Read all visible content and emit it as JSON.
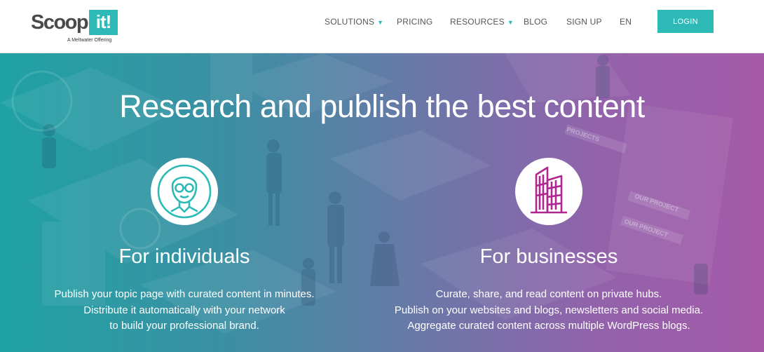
{
  "header": {
    "logo": {
      "word": "Scoop.",
      "box": "it!",
      "tagline": "A Meltwater Offering"
    },
    "nav": [
      {
        "label": "SOLUTIONS",
        "dropdown": true
      },
      {
        "label": "PRICING",
        "dropdown": false
      },
      {
        "label": "RESOURCES",
        "dropdown": true
      },
      {
        "label": "BLOG",
        "dropdown": false
      },
      {
        "label": "SIGN UP",
        "dropdown": false
      },
      {
        "label": "EN",
        "dropdown": false
      }
    ],
    "caret_glyph": "▼",
    "login_label": "LOGIN"
  },
  "hero": {
    "title": "Research and publish the best content",
    "individuals": {
      "icon": "person-glasses-icon",
      "title": "For individuals",
      "lines": [
        "Publish your topic page with curated content in minutes.",
        "Distribute it automatically with your network",
        "to build your professional brand."
      ]
    },
    "businesses": {
      "icon": "office-buildings-icon",
      "title": "For businesses",
      "lines": [
        "Curate, share, and read content on private hubs.",
        "Publish on your websites and blogs, newsletters and social media.",
        "Aggregate curated content across multiple WordPress blogs."
      ]
    },
    "illustration_labels": [
      "PROJECTS",
      "OUR PROJECT",
      "OUR PROJECT"
    ]
  },
  "colors": {
    "accent": "#2dbab6",
    "businesses_icon": "#b0258f",
    "gradient_left": "#1fa2a3",
    "gradient_right": "#a55aa9"
  }
}
